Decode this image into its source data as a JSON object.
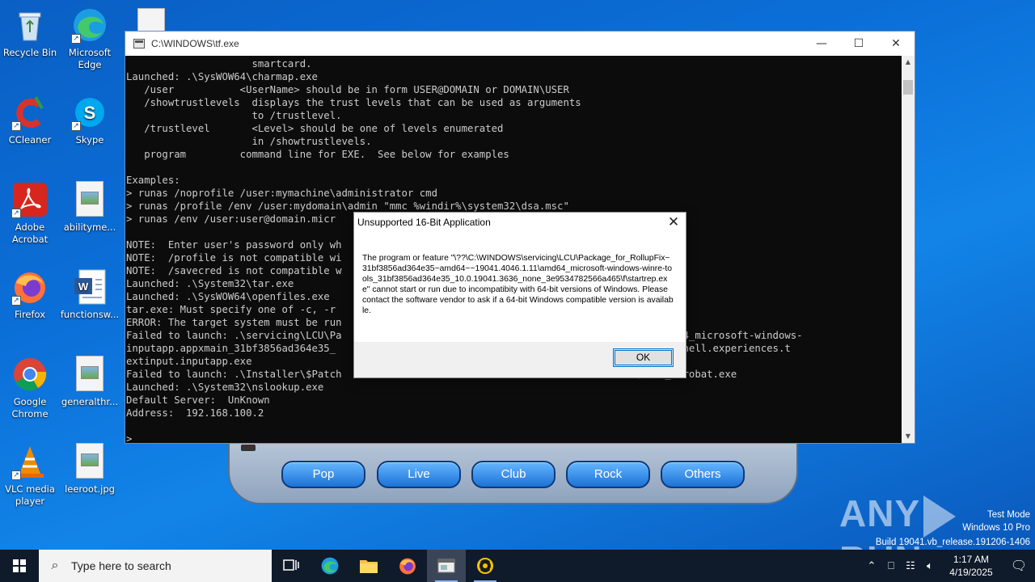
{
  "desktop": {
    "icons": [
      {
        "label": "Recycle Bin"
      },
      {
        "label": "Microsoft Edge"
      },
      {
        "label": "CCleaner"
      },
      {
        "label": "Skype"
      },
      {
        "label": "Adobe Acrobat"
      },
      {
        "label": "abilityme..."
      },
      {
        "label": "Firefox"
      },
      {
        "label": "functionsw..."
      },
      {
        "label": "Google Chrome"
      },
      {
        "label": "generalthr..."
      },
      {
        "label": "VLC media player"
      },
      {
        "label": "leeroot.jpg"
      }
    ]
  },
  "player": {
    "buttons": [
      "Pop",
      "Live",
      "Club",
      "Rock",
      "Others"
    ]
  },
  "console": {
    "title": "C:\\WINDOWS\\tf.exe",
    "text": "                     smartcard.\nLaunched: .\\SysWOW64\\charmap.exe\n   /user           <UserName> should be in form USER@DOMAIN or DOMAIN\\USER\n   /showtrustlevels  displays the trust levels that can be used as arguments\n                     to /trustlevel.\n   /trustlevel       <Level> should be one of levels enumerated\n                     in /showtrustlevels.\n   program         command line for EXE.  See below for examples\n\nExamples:\n> runas /noprofile /user:mymachine\\administrator cmd\n> runas /profile /env /user:mydomain\\admin \"mmc %windir%\\system32\\dsa.msc\"\n> runas /env /user:user@domain.micr\n\nNOTE:  Enter user's password only wh\nNOTE:  /profile is not compatible wi\nNOTE:  /savecred is not compatible w\nLaunched: .\\System32\\tar.exe\nLaunched: .\\SysWOW64\\openfiles.exe\ntar.exe: Must specify one of -c, -r\nERROR: The target system must be run\nFailed to launch: .\\servicing\\LCU\\Pa                                            046.1.11\\amd64_microsoft-windows-\ninputapp.appxmain_31bf3856ad364e35_                                           nal.composableshell.experiences.t\nextinput.inputapp.exe\nFailed to launch: .\\Installer\\$Patch                                          1.20135\\Exch_Acrobat.exe\nLaunched: .\\System32\\nslookup.exe\nDefault Server:  UnKnown\nAddress:  192.168.100.2\n\n>"
  },
  "dialog": {
    "title": "Unsupported 16-Bit Application",
    "message": "The program or feature \"\\??\\C:\\WINDOWS\\servicing\\LCU\\Package_for_RollupFix~31bf3856ad364e35~amd64~~19041.4046.1.11\\amd64_microsoft-windows-winre-tools_31bf3856ad364e35_10.0.19041.3636_none_3e9534782566a465\\f\\startrep.exe\" cannot start or run due to incompatibity with 64-bit versions of Windows. Please contact the software vendor to ask if a 64-bit Windows compatible version is available.",
    "ok_label": "OK"
  },
  "watermark": {
    "brand": "ANY",
    "brand2": "RUN",
    "mode": "Test Mode",
    "edition": "Windows 10 Pro",
    "build": "Build 19041.vb_release.191206-1406"
  },
  "taskbar": {
    "search_placeholder": "Type here to search",
    "time": "1:17 AM",
    "date": "4/19/2025"
  }
}
